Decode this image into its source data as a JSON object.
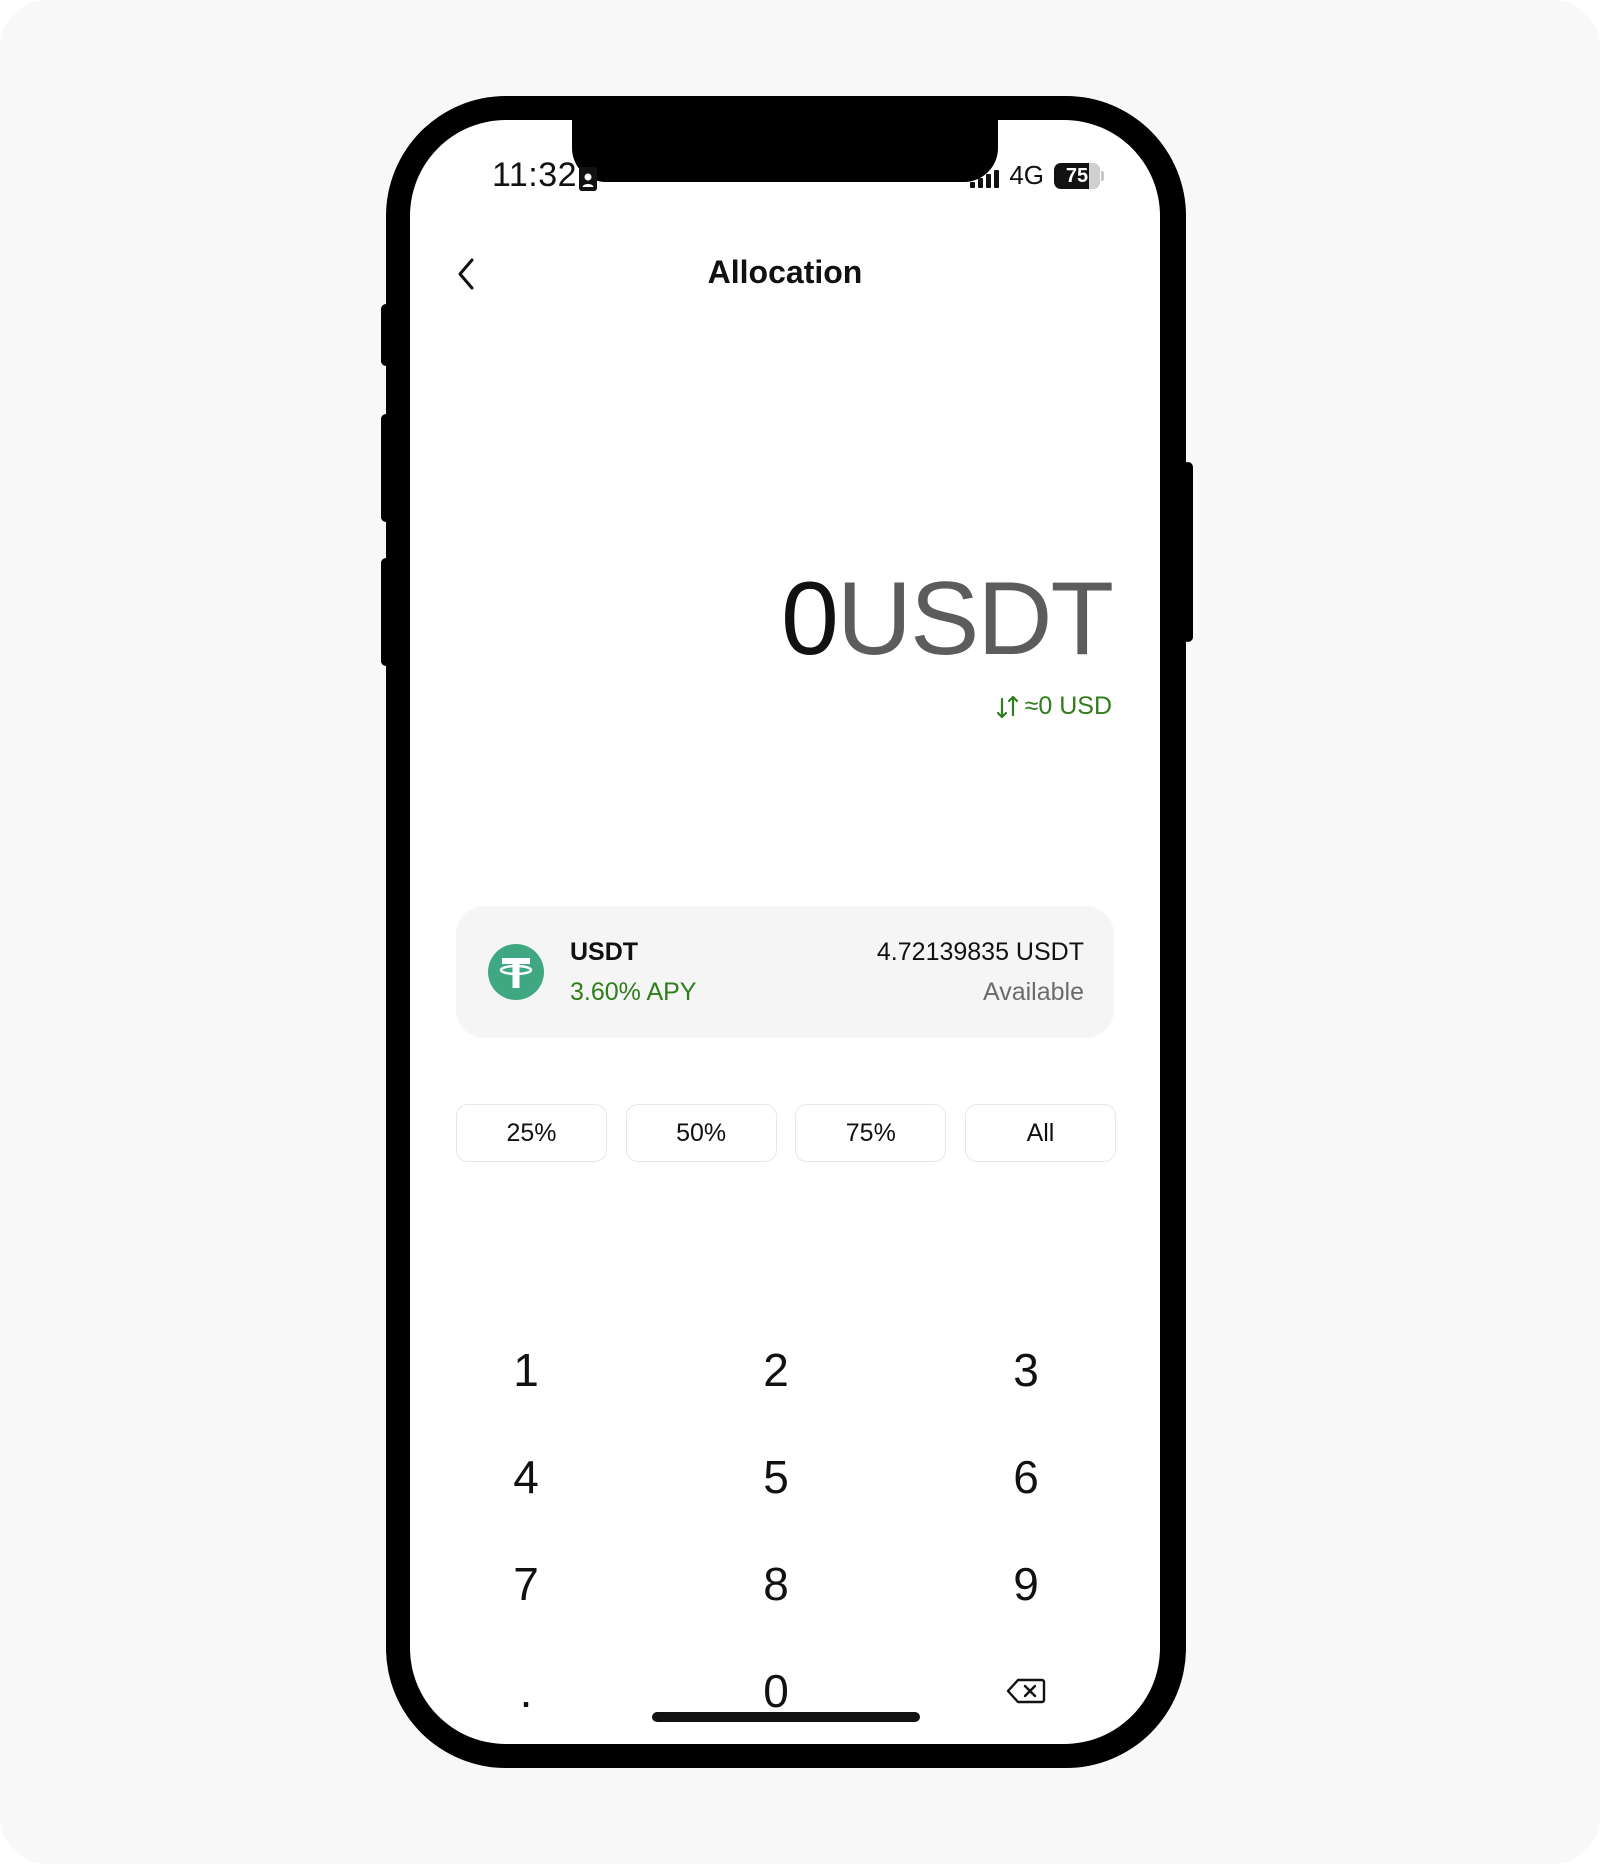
{
  "status_bar": {
    "time": "11:32",
    "network": "4G",
    "battery_level": "75",
    "battery_percent": 75
  },
  "header": {
    "title": "Allocation",
    "back_icon": "chevron-left-icon"
  },
  "amount": {
    "value": "0",
    "unit": "USDT",
    "conversion": "≈0 USD",
    "conversion_icon": "swap-arrows-icon"
  },
  "asset": {
    "symbol": "USDT",
    "apy": "3.60% APY",
    "balance": "4.72139835 USDT",
    "available_label": "Available",
    "logo_icon": "tether-logo-icon"
  },
  "percent_buttons": [
    "25%",
    "50%",
    "75%",
    "All"
  ],
  "keypad": {
    "keys": [
      "1",
      "2",
      "3",
      "4",
      "5",
      "6",
      "7",
      "8",
      "9",
      ".",
      "0"
    ],
    "backspace_icon": "backspace-icon"
  },
  "colors": {
    "accent_green": "#2f7d1b",
    "tether_green": "#3fa882",
    "card_bg": "#f5f5f5"
  }
}
